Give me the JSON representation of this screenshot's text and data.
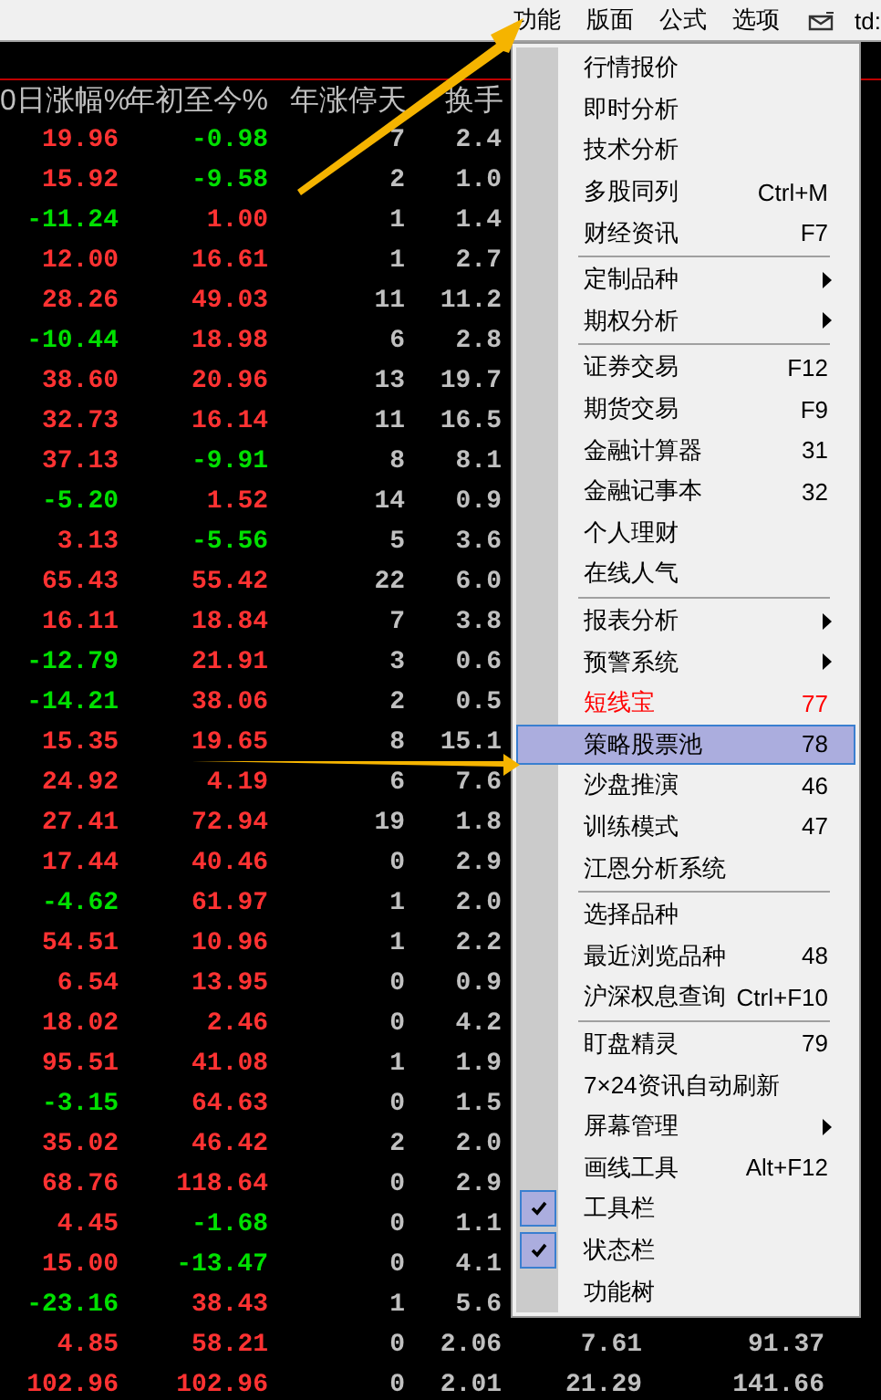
{
  "menu_bar": {
    "items": [
      "功能",
      "版面",
      "公式",
      "选项"
    ],
    "account": "td:"
  },
  "table": {
    "columns": [
      "0日涨幅%",
      "年初至今%",
      "年涨停天",
      "换手"
    ],
    "rows": [
      {
        "cells": [
          "19.96",
          "-0.98",
          "7",
          "2.4"
        ],
        "falling": [
          false,
          true
        ]
      },
      {
        "cells": [
          "15.92",
          "-9.58",
          "2",
          "1.0"
        ],
        "falling": [
          false,
          true
        ]
      },
      {
        "cells": [
          "-11.24",
          "1.00",
          "1",
          "1.4"
        ],
        "falling": [
          true,
          false
        ]
      },
      {
        "cells": [
          "12.00",
          "16.61",
          "1",
          "2.7"
        ],
        "falling": [
          false,
          false
        ]
      },
      {
        "cells": [
          "28.26",
          "49.03",
          "11",
          "11.2"
        ],
        "falling": [
          false,
          false
        ]
      },
      {
        "cells": [
          "-10.44",
          "18.98",
          "6",
          "2.8"
        ],
        "falling": [
          true,
          false
        ]
      },
      {
        "cells": [
          "38.60",
          "20.96",
          "13",
          "19.7"
        ],
        "falling": [
          false,
          false
        ]
      },
      {
        "cells": [
          "32.73",
          "16.14",
          "11",
          "16.5"
        ],
        "falling": [
          false,
          false
        ]
      },
      {
        "cells": [
          "37.13",
          "-9.91",
          "8",
          "8.1"
        ],
        "falling": [
          false,
          true
        ]
      },
      {
        "cells": [
          "-5.20",
          "1.52",
          "14",
          "0.9"
        ],
        "falling": [
          true,
          false
        ]
      },
      {
        "cells": [
          "3.13",
          "-5.56",
          "5",
          "3.6"
        ],
        "falling": [
          false,
          true
        ]
      },
      {
        "cells": [
          "65.43",
          "55.42",
          "22",
          "6.0"
        ],
        "falling": [
          false,
          false
        ]
      },
      {
        "cells": [
          "16.11",
          "18.84",
          "7",
          "3.8"
        ],
        "falling": [
          false,
          false
        ]
      },
      {
        "cells": [
          "-12.79",
          "21.91",
          "3",
          "0.6"
        ],
        "falling": [
          true,
          false
        ]
      },
      {
        "cells": [
          "-14.21",
          "38.06",
          "2",
          "0.5"
        ],
        "falling": [
          true,
          false
        ]
      },
      {
        "cells": [
          "15.35",
          "19.65",
          "8",
          "15.1"
        ],
        "falling": [
          false,
          false
        ]
      },
      {
        "cells": [
          "24.92",
          "4.19",
          "6",
          "7.6"
        ],
        "falling": [
          false,
          false
        ]
      },
      {
        "cells": [
          "27.41",
          "72.94",
          "19",
          "1.8"
        ],
        "falling": [
          false,
          false
        ]
      },
      {
        "cells": [
          "17.44",
          "40.46",
          "0",
          "2.9"
        ],
        "falling": [
          false,
          false
        ]
      },
      {
        "cells": [
          "-4.62",
          "61.97",
          "1",
          "2.0"
        ],
        "falling": [
          true,
          false
        ]
      },
      {
        "cells": [
          "54.51",
          "10.96",
          "1",
          "2.2"
        ],
        "falling": [
          false,
          false
        ]
      },
      {
        "cells": [
          "6.54",
          "13.95",
          "0",
          "0.9"
        ],
        "falling": [
          false,
          false
        ]
      },
      {
        "cells": [
          "18.02",
          "2.46",
          "0",
          "4.2"
        ],
        "falling": [
          false,
          false
        ]
      },
      {
        "cells": [
          "95.51",
          "41.08",
          "1",
          "1.9"
        ],
        "falling": [
          false,
          false
        ]
      },
      {
        "cells": [
          "-3.15",
          "64.63",
          "0",
          "1.5"
        ],
        "falling": [
          true,
          false
        ]
      },
      {
        "cells": [
          "35.02",
          "46.42",
          "2",
          "2.0"
        ],
        "falling": [
          false,
          false
        ]
      },
      {
        "cells": [
          "68.76",
          "118.64",
          "0",
          "2.9"
        ],
        "falling": [
          false,
          false
        ]
      },
      {
        "cells": [
          "4.45",
          "-1.68",
          "0",
          "1.1"
        ],
        "falling": [
          false,
          true
        ]
      },
      {
        "cells": [
          "15.00",
          "-13.47",
          "0",
          "4.1"
        ],
        "falling": [
          false,
          true
        ]
      },
      {
        "cells": [
          "-23.16",
          "38.43",
          "1",
          "5.6"
        ],
        "falling": [
          true,
          false
        ]
      },
      {
        "cells": [
          "4.85",
          "58.21",
          "0",
          "2.06",
          "7.61",
          "91.37"
        ],
        "falling": [
          false,
          false
        ]
      },
      {
        "cells": [
          "102.96",
          "102.96",
          "0",
          "2.01",
          "21.29",
          "141.66"
        ],
        "falling": [
          false,
          false
        ]
      }
    ]
  },
  "popup_menu": {
    "items": [
      {
        "kind": "item",
        "label": "行情报价",
        "selected": false,
        "checked": false
      },
      {
        "kind": "item",
        "label": "即时分析",
        "selected": false,
        "checked": false
      },
      {
        "kind": "item",
        "label": "技术分析",
        "selected": false,
        "checked": false
      },
      {
        "kind": "item",
        "label": "多股同列",
        "shortcut": "Ctrl+M",
        "selected": false,
        "checked": false
      },
      {
        "kind": "item",
        "label": "财经资讯",
        "shortcut": "F7",
        "selected": false,
        "checked": false
      },
      {
        "kind": "separator"
      },
      {
        "kind": "submenu",
        "label": "定制品种",
        "selected": false,
        "checked": false
      },
      {
        "kind": "submenu",
        "label": "期权分析",
        "selected": false,
        "checked": false
      },
      {
        "kind": "separator"
      },
      {
        "kind": "item",
        "label": "证券交易",
        "shortcut": "F12",
        "selected": false,
        "checked": false
      },
      {
        "kind": "item",
        "label": "期货交易",
        "shortcut": "F9",
        "selected": false,
        "checked": false
      },
      {
        "kind": "item",
        "label": "金融计算器",
        "shortcut": "31",
        "selected": false,
        "checked": false
      },
      {
        "kind": "item",
        "label": "金融记事本",
        "shortcut": "32",
        "selected": false,
        "checked": false
      },
      {
        "kind": "item",
        "label": "个人理财",
        "selected": false,
        "checked": false
      },
      {
        "kind": "item",
        "label": "在线人气",
        "selected": false,
        "checked": false
      },
      {
        "kind": "separator"
      },
      {
        "kind": "submenu",
        "label": "报表分析",
        "selected": false,
        "checked": false
      },
      {
        "kind": "submenu",
        "label": "预警系统",
        "selected": false,
        "checked": false
      },
      {
        "kind": "item",
        "label": "短线宝",
        "shortcut": "77",
        "color": "#ff0000",
        "selected": false,
        "checked": false
      },
      {
        "kind": "item",
        "label": "策略股票池",
        "shortcut": "78",
        "selected": true,
        "checked": false
      },
      {
        "kind": "item",
        "label": "沙盘推演",
        "shortcut": "46",
        "selected": false,
        "checked": false
      },
      {
        "kind": "item",
        "label": "训练模式",
        "shortcut": "47",
        "selected": false,
        "checked": false
      },
      {
        "kind": "item",
        "label": "江恩分析系统",
        "selected": false,
        "checked": false
      },
      {
        "kind": "separator"
      },
      {
        "kind": "item",
        "label": "选择品种",
        "selected": false,
        "checked": false
      },
      {
        "kind": "item",
        "label": "最近浏览品种",
        "shortcut": "48",
        "selected": false,
        "checked": false
      },
      {
        "kind": "item",
        "label": "沪深权息查询",
        "shortcut": "Ctrl+F10",
        "selected": false,
        "checked": false
      },
      {
        "kind": "separator"
      },
      {
        "kind": "item",
        "label": "盯盘精灵",
        "shortcut": "79",
        "selected": false,
        "checked": false
      },
      {
        "kind": "item",
        "label": "7×24资讯自动刷新",
        "selected": false,
        "checked": false
      },
      {
        "kind": "submenu",
        "label": "屏幕管理",
        "selected": false,
        "checked": false
      },
      {
        "kind": "item",
        "label": "画线工具",
        "shortcut": "Alt+F12",
        "selected": false,
        "checked": false
      },
      {
        "kind": "item",
        "label": "工具栏",
        "selected": false,
        "checked": true
      },
      {
        "kind": "item",
        "label": "状态栏",
        "selected": false,
        "checked": true
      },
      {
        "kind": "item",
        "label": "功能树",
        "selected": false,
        "checked": false
      }
    ]
  }
}
